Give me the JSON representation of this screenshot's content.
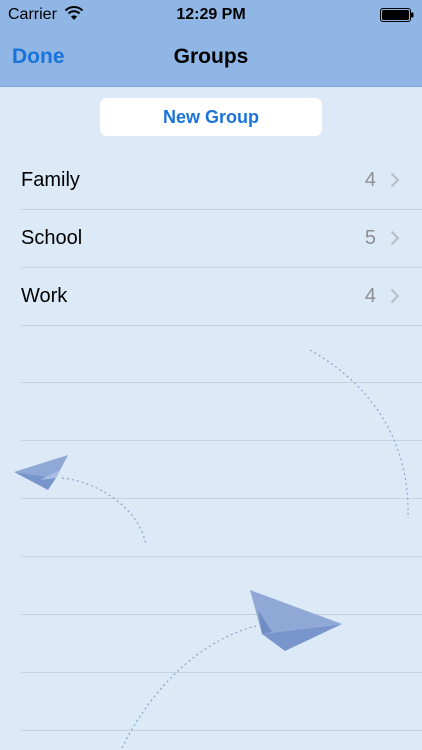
{
  "status_bar": {
    "carrier": "Carrier",
    "time": "12:29 PM"
  },
  "nav": {
    "done_label": "Done",
    "title": "Groups"
  },
  "new_group_label": "New Group",
  "groups": [
    {
      "name": "Family",
      "count": "4"
    },
    {
      "name": "School",
      "count": "5"
    },
    {
      "name": "Work",
      "count": "4"
    }
  ],
  "colors": {
    "accent": "#1a73d9",
    "bar": "#8fb6e4",
    "background": "#dceaf8"
  },
  "icons": [
    "wifi-icon",
    "battery-icon",
    "chevron-right-icon",
    "paper-plane-icon"
  ]
}
